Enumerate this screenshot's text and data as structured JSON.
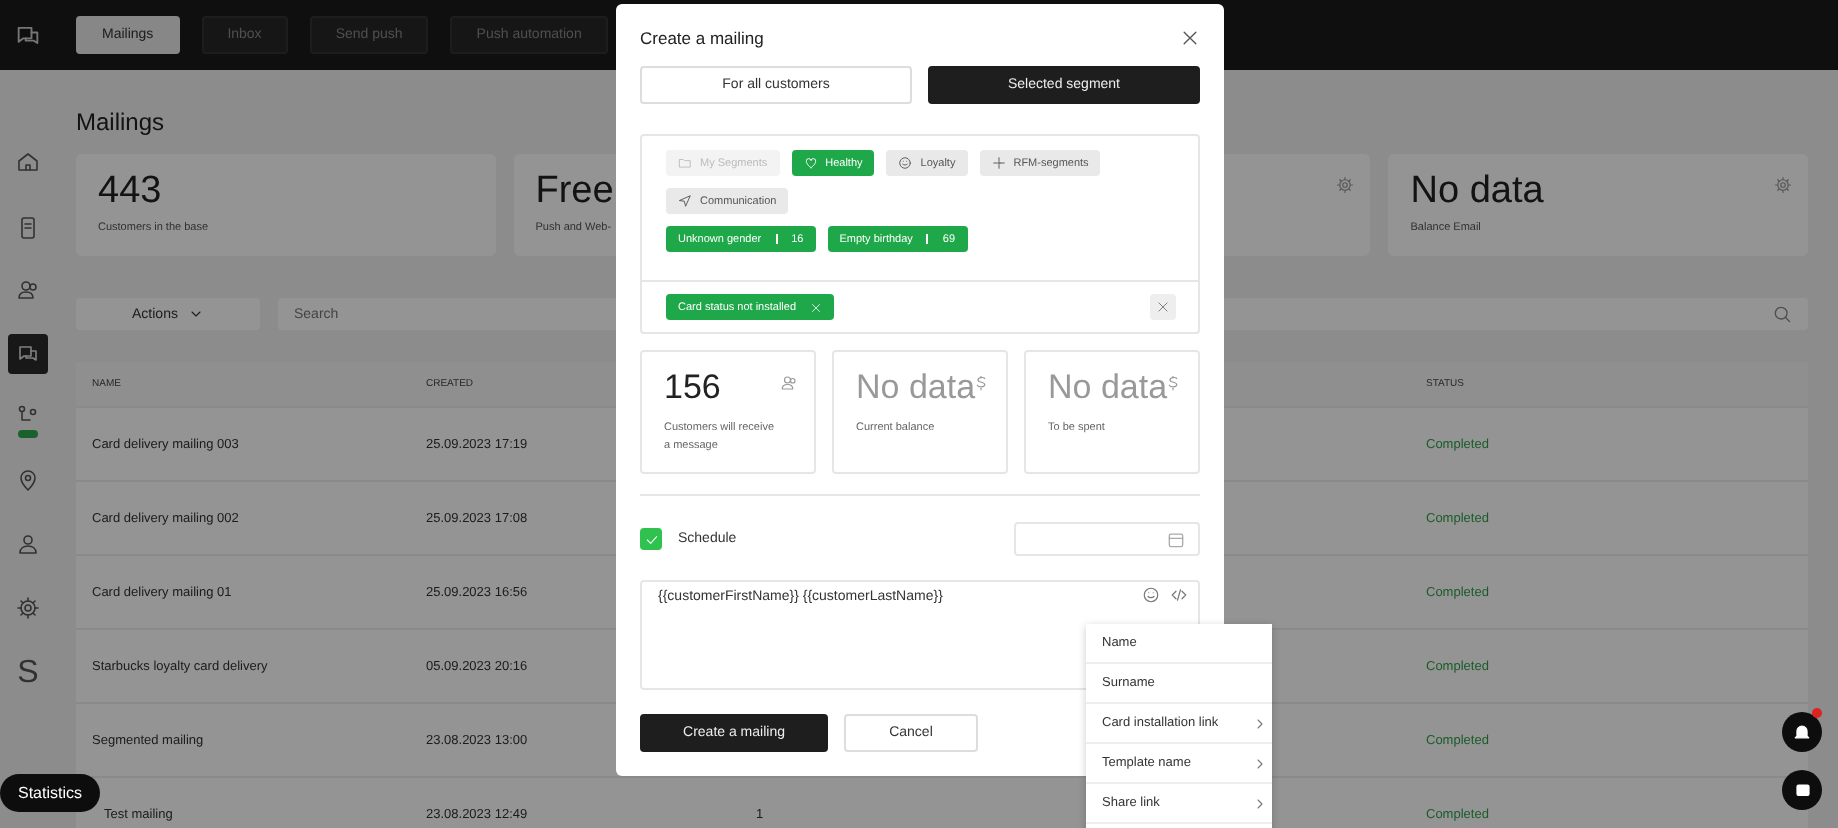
{
  "nav": {
    "tabs": [
      {
        "label": "Mailings",
        "selected": true
      },
      {
        "label": "Inbox",
        "selected": false
      },
      {
        "label": "Send push",
        "selected": false
      },
      {
        "label": "Push automation",
        "selected": false
      }
    ]
  },
  "sidebar": {
    "items": [
      {
        "selected": false
      },
      {
        "selected": false
      },
      {
        "selected": false
      },
      {
        "selected": true
      },
      {
        "selected": false
      },
      {
        "selected": false
      },
      {
        "selected": false
      },
      {
        "selected": false
      }
    ],
    "logo": "S"
  },
  "page": {
    "title": "Mailings",
    "stats": [
      {
        "value": "443",
        "label": "Customers in the base",
        "settings": false
      },
      {
        "value": "Free",
        "label": "Push and Web-"
      },
      {
        "settings": true
      },
      {
        "value": "No data",
        "label": "Balance Email",
        "settings": true
      }
    ],
    "actions": "Actions",
    "search": {
      "placeholder": "Search"
    }
  },
  "table": {
    "columns": [
      "NAME",
      "CREATED",
      "",
      "STATUS"
    ],
    "rows": [
      {
        "name": "Card delivery mailing 003",
        "created": "25.09.2023 17:19",
        "status": "Completed"
      },
      {
        "name": "Card delivery mailing 002",
        "created": "25.09.2023 17:08",
        "status": "Completed"
      },
      {
        "name": "Card delivery mailing 01",
        "created": "25.09.2023 16:56",
        "status": "Completed"
      },
      {
        "name": "Starbucks loyalty card delivery",
        "created": "05.09.2023 20:16",
        "status": "Completed"
      },
      {
        "name": "Segmented mailing",
        "created": "23.08.2023 13:00",
        "status": "Completed"
      },
      {
        "name": "Test mailing",
        "created": "23.08.2023 12:49",
        "column_3": "1",
        "status": "Completed"
      }
    ]
  },
  "modal": {
    "title": "Create a mailing",
    "audience": [
      {
        "label": "For all customers",
        "selected": false
      },
      {
        "label": "Selected segment",
        "selected": true
      }
    ],
    "segment_tabs": [
      {
        "label": "My Segments",
        "selected": false,
        "disabled": true
      },
      {
        "label": "Healthy",
        "selected": true,
        "disabled": false
      },
      {
        "label": "Loyalty",
        "selected": false,
        "disabled": false
      },
      {
        "label": "RFM-segments",
        "selected": false,
        "disabled": false
      },
      {
        "label": "Communication",
        "selected": false,
        "disabled": false
      }
    ],
    "segments": [
      {
        "label": "Unknown gender",
        "count": "16"
      },
      {
        "label": "Empty birthday",
        "count": "69"
      }
    ],
    "filters": [
      {
        "label": "Card status not installed"
      }
    ],
    "cards": [
      {
        "value": "156",
        "label": "Customers will receive a message",
        "empty": false
      },
      {
        "value": "No data",
        "label": "Current balance",
        "empty": true
      },
      {
        "value": "No data",
        "label": "To be spent",
        "empty": true
      }
    ],
    "schedule": {
      "label": "Schedule",
      "checked": true
    },
    "message": {
      "value": "{{customerFirstName}} {{customerLastName}}"
    },
    "buttons": [
      {
        "label": "Create a mailing",
        "kind": "primary"
      },
      {
        "label": "Cancel",
        "kind": "secondary"
      }
    ]
  },
  "menu": {
    "items": [
      {
        "label": "Name",
        "submenu": false
      },
      {
        "label": "Surname",
        "submenu": false
      },
      {
        "label": "Card installation link",
        "submenu": true
      },
      {
        "label": "Template name",
        "submenu": true
      },
      {
        "label": "Share link",
        "submenu": true
      }
    ]
  },
  "statistics": "Statistics"
}
